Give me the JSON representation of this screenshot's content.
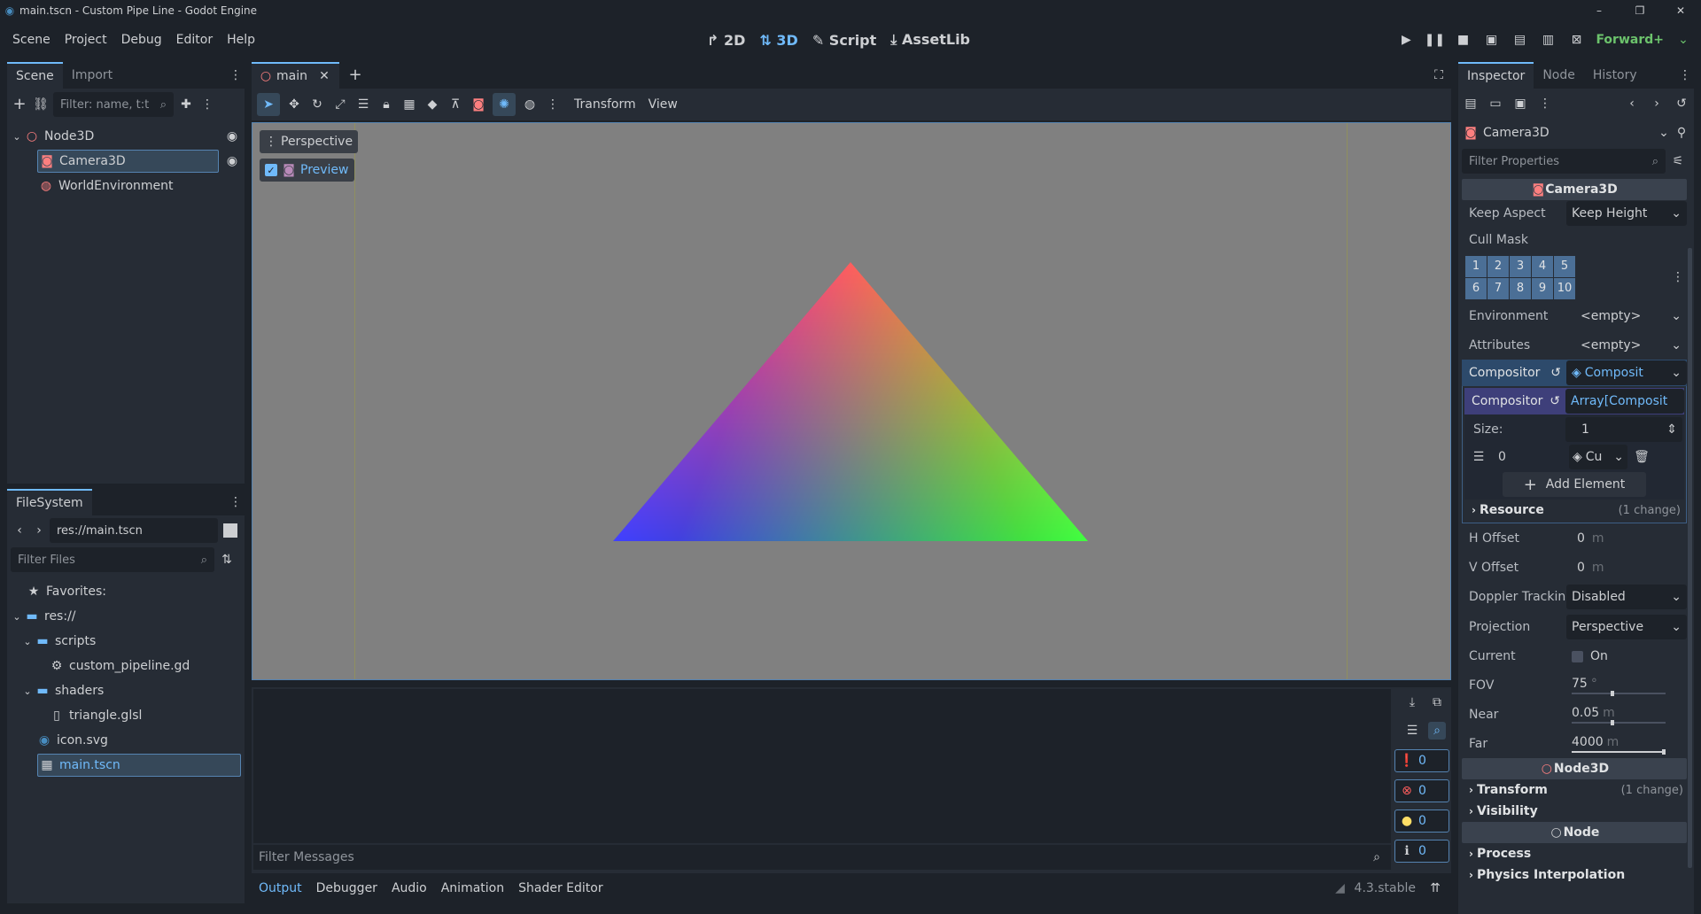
{
  "window": {
    "title": "main.tscn - Custom Pipe Line - Godot Engine",
    "minimize": "–",
    "maximize": "❐",
    "close": "✕"
  },
  "menu": {
    "items": [
      "Scene",
      "Project",
      "Debug",
      "Editor",
      "Help"
    ]
  },
  "workspaces": {
    "items": [
      {
        "icon": "↱",
        "label": "2D"
      },
      {
        "icon": "⇅",
        "label": "3D"
      },
      {
        "icon": "✎",
        "label": "Script"
      },
      {
        "icon": "⤓",
        "label": "AssetLib"
      }
    ]
  },
  "renderer": "Forward+",
  "scene_dock": {
    "tabs": [
      "Scene",
      "Import"
    ],
    "filter_placeholder": "Filter: name, t:t",
    "nodes": [
      {
        "label": "Node3D"
      },
      {
        "label": "Camera3D"
      },
      {
        "label": "WorldEnvironment"
      }
    ]
  },
  "filesystem": {
    "tab": "FileSystem",
    "path": "res://main.tscn",
    "filter_placeholder": "Filter Files",
    "items": [
      {
        "label": "Favorites:"
      },
      {
        "label": "res://"
      },
      {
        "label": "scripts"
      },
      {
        "label": "custom_pipeline.gd"
      },
      {
        "label": "shaders"
      },
      {
        "label": "triangle.glsl"
      },
      {
        "label": "icon.svg"
      },
      {
        "label": "main.tscn"
      }
    ]
  },
  "editor_tabs": {
    "scene_tab": "main"
  },
  "viewport_toolbar": {
    "transform_menu": "Transform",
    "view_menu": "View",
    "perspective_label": "Perspective",
    "preview_label": "Preview"
  },
  "triangle": {
    "colors": [
      "#ff0000",
      "#00ff00",
      "#0000ff"
    ]
  },
  "bottom_panel": {
    "filter_placeholder": "Filter Messages",
    "tabs": [
      "Output",
      "Debugger",
      "Audio",
      "Animation",
      "Shader Editor"
    ],
    "version": "4.3.stable",
    "counters": [
      "0",
      "0",
      "0",
      "0"
    ]
  },
  "inspector": {
    "tabs": [
      "Inspector",
      "Node",
      "History"
    ],
    "object_name": "Camera3D",
    "filter_placeholder": "Filter Properties",
    "section_camera": "Camera3D",
    "keep_aspect": {
      "label": "Keep Aspect",
      "value": "Keep Height"
    },
    "cull_mask": {
      "label": "Cull Mask",
      "layers": [
        "1",
        "2",
        "3",
        "4",
        "5",
        "6",
        "7",
        "8",
        "9",
        "10"
      ]
    },
    "environment": {
      "label": "Environment",
      "value": "<empty>"
    },
    "attributes": {
      "label": "Attributes",
      "value": "<empty>"
    },
    "compositor": {
      "label": "Compositor",
      "value": "Composit"
    },
    "compositor_effects": {
      "label": "Compositor",
      "value": "Array[Composit"
    },
    "size": {
      "label": "Size:",
      "value": "1"
    },
    "element": {
      "index": "0",
      "value": "Cu"
    },
    "add_element": "Add Element",
    "resource": {
      "label": "Resource",
      "note": "(1 change)"
    },
    "h_offset": {
      "label": "H Offset",
      "value": "0",
      "unit": "m"
    },
    "v_offset": {
      "label": "V Offset",
      "value": "0",
      "unit": "m"
    },
    "doppler": {
      "label": "Doppler Trackin",
      "value": "Disabled"
    },
    "projection": {
      "label": "Projection",
      "value": "Perspective"
    },
    "current": {
      "label": "Current",
      "value": "On"
    },
    "fov": {
      "label": "FOV",
      "value": "75",
      "unit": "°"
    },
    "near": {
      "label": "Near",
      "value": "0.05",
      "unit": "m"
    },
    "far": {
      "label": "Far",
      "value": "4000",
      "unit": "m"
    },
    "section_node3d": "Node3D",
    "transform": {
      "label": "Transform",
      "note": "(1 change)"
    },
    "visibility": {
      "label": "Visibility"
    },
    "section_node": "Node",
    "process": {
      "label": "Process"
    },
    "physics_interp": {
      "label": "Physics Interpolation"
    }
  }
}
